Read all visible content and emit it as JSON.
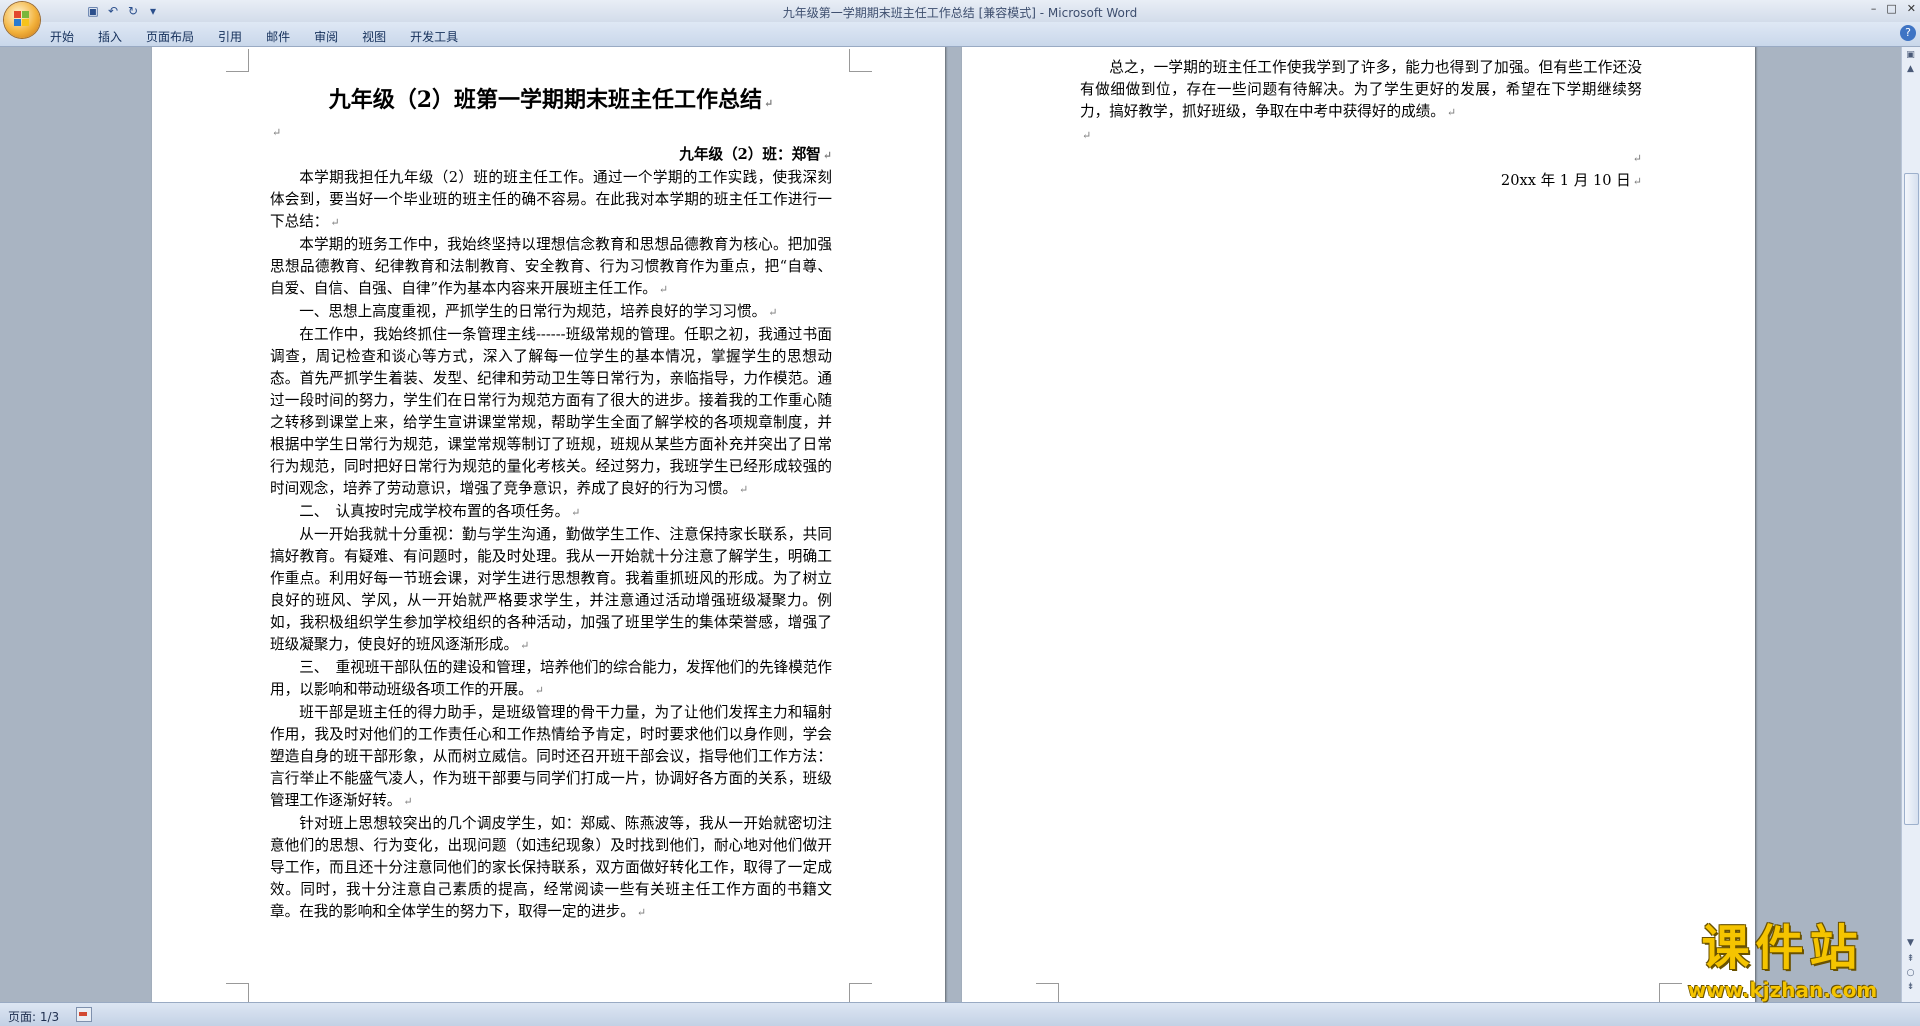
{
  "window": {
    "title": "九年级第一学期期末班主任工作总结 [兼容模式] - Microsoft Word",
    "controls": [
      "–",
      "□",
      "✕"
    ]
  },
  "qat": {
    "icons": [
      "save-icon",
      "undo-icon",
      "redo-icon",
      "customize-icon"
    ],
    "glyphs": [
      "▣",
      "↶",
      "↻",
      "▾"
    ]
  },
  "ribbon": {
    "tabs": [
      "开始",
      "插入",
      "页面布局",
      "引用",
      "邮件",
      "审阅",
      "视图",
      "开发工具"
    ],
    "help": "?"
  },
  "document": {
    "page1": {
      "title": "九年级（2）班第一学期期末班主任工作总结",
      "author": "九年级（2）班：郑智",
      "paragraphs": [
        "本学期我担任九年级（2）班的班主任工作。通过一个学期的工作实践，使我深刻体会到，要当好一个毕业班的班主任的确不容易。在此我对本学期的班主任工作进行一下总结：",
        "本学期的班务工作中，我始终坚持以理想信念教育和思想品德教育为核心。把加强思想品德教育、纪律教育和法制教育、安全教育、行为习惯教育作为重点，把“自尊、自爱、自信、自强、自律”作为基本内容来开展班主任工作。",
        "一、思想上高度重视，严抓学生的日常行为规范，培养良好的学习习惯。",
        "在工作中，我始终抓住一条管理主线------班级常规的管理。任职之初，我通过书面调查，周记检查和谈心等方式，深入了解每一位学生的基本情况，掌握学生的思想动态。首先严抓学生着装、发型、纪律和劳动卫生等日常行为，亲临指导，力作模范。通过一段时间的努力，学生们在日常行为规范方面有了很大的进步。接着我的工作重心随之转移到课堂上来，给学生宣讲课堂常规，帮助学生全面了解学校的各项规章制度，并根据中学生日常行为规范，课堂常规等制订了班规，班规从某些方面补充并突出了日常行为规范，同时把好日常行为规范的量化考核关。经过努力，我班学生已经形成较强的时间观念，培养了劳动意识，增强了竞争意识，养成了良好的行为习惯。",
        "二、　认真按时完成学校布置的各项任务。",
        "从一开始我就十分重视：勤与学生沟通，勤做学生工作、注意保持家长联系，共同搞好教育。有疑难、有问题时，能及时处理。我从一开始就十分注意了解学生，明确工作重点。利用好每一节班会课，对学生进行思想教育。我着重抓班风的形成。为了树立良好的班风、学风，从一开始就严格要求学生，并注意通过活动增强班级凝聚力。例如，我积极组织学生参加学校组织的各种活动，加强了班里学生的集体荣誉感，增强了班级凝聚力，使良好的班风逐渐形成。",
        "三、　重视班干部队伍的建设和管理，培养他们的综合能力，发挥他们的先锋模范作用，以影响和带动班级各项工作的开展。",
        "班干部是班主任的得力助手，是班级管理的骨干力量，为了让他们发挥主力和辐射作用，我及时对他们的工作责任心和工作热情给予肯定，时时要求他们以身作则，学会塑造自身的班干部形象，从而树立威信。同时还召开班干部会议，指导他们工作方法：言行举止不能盛气凌人，作为班干部要与同学们打成一片，协调好各方面的关系，班级管理工作逐渐好转。",
        "针对班上思想较突出的几个调皮学生，如：郑威、陈燕波等，我从一开始就密切注意他们的思想、行为变化，出现问题（如违纪现象）及时找到他们，耐心地对他们做开导工作，而且还十分注意同他们的家长保持联系，双方面做好转化工作，取得了一定成效。同时，我十分注意自己素质的提高，经常阅读一些有关班主任工作方面的书籍文章。在我的影响和全体学生的努力下，取得一定的进步。"
      ]
    },
    "page2": {
      "paragraphs": [
        "总之，一学期的班主任工作使我学到了许多，能力也得到了加强。但有些工作还没有做细做到位，存在一些问题有待解决。为了学生更好的发展，希望在下学期继续努力，搞好教学，抓好班级，争取在中考中获得好的成绩。"
      ],
      "date": "20xx 年 1 月 10 日"
    },
    "paragraph_mark": "↵"
  },
  "status": {
    "page": "页面: 1/3"
  },
  "watermark": {
    "text": "课件站",
    "url": "www.kjzhan.com"
  },
  "colors": {
    "page_bg": "#a9b4c2",
    "ribbon": "#dfe8f5",
    "office_button": "#f3b33d",
    "watermark": "#f5c400"
  }
}
